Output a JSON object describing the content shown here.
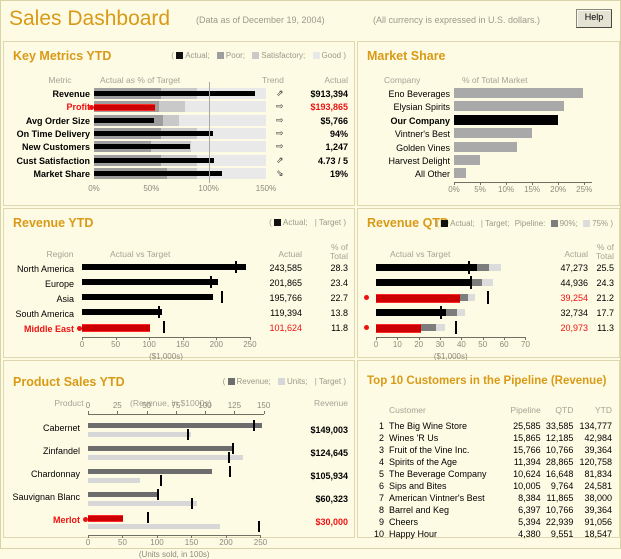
{
  "header": {
    "title": "Sales Dashboard",
    "as_of": "(Data as of December 19, 2004)",
    "currency_note": "(All currency is expressed in U.S. dollars.)",
    "help_label": "Help"
  },
  "key_metrics": {
    "title": "Key Metrics YTD",
    "legend": {
      "open": "(",
      "actual": "Actual;",
      "poor": "Poor;",
      "satisfactory": "Satisfactory;",
      "good": "Good",
      "close": ")"
    },
    "columns": {
      "metric": "Metric",
      "chart": "Actual as % of Target",
      "trend": "Trend",
      "actual": "Actual"
    },
    "axis_ticks": [
      "0%",
      "50%",
      "100%",
      "150%"
    ],
    "rows": [
      {
        "label": "Revenue",
        "actual_pct": 140,
        "poor": 58,
        "sat": 90,
        "good": 150,
        "trend": "up-right-arrow",
        "value": "$913,394",
        "alert": false
      },
      {
        "label": "Profit",
        "actual_pct": 53,
        "poor": 57,
        "sat": 79,
        "good": 150,
        "trend": "right-arrow",
        "value": "$193,865",
        "alert": true
      },
      {
        "label": "Avg Order Size",
        "actual_pct": 52,
        "poor": 60,
        "sat": 74,
        "good": 150,
        "trend": "right-arrow",
        "value": "$5,766",
        "alert": false
      },
      {
        "label": "On Time Delivery",
        "actual_pct": 104,
        "poor": 58,
        "sat": 90,
        "good": 150,
        "trend": "right-arrow",
        "value": "94%",
        "alert": false
      },
      {
        "label": "New Customers",
        "actual_pct": 84,
        "poor": 50,
        "sat": 85,
        "good": 150,
        "trend": "right-arrow",
        "value": "1,247",
        "alert": false
      },
      {
        "label": "Cust Satisfaction",
        "actual_pct": 105,
        "poor": 58,
        "sat": 90,
        "good": 150,
        "trend": "up-right-arrow",
        "value": "4.73 / 5",
        "alert": false
      },
      {
        "label": "Market Share",
        "actual_pct": 112,
        "poor": 64,
        "sat": 90,
        "good": 150,
        "trend": "down-right-arrow",
        "value": "19%",
        "alert": false
      }
    ]
  },
  "market_share": {
    "title": "Market Share",
    "columns": {
      "company": "Company",
      "chart": "% of Total Market"
    },
    "axis_ticks": [
      "0%",
      "5%",
      "10%",
      "15%",
      "20%",
      "25%"
    ],
    "rows": [
      {
        "label": "Eno Beverages",
        "value": 24.8,
        "highlight": false
      },
      {
        "label": "Elysian Spirits",
        "value": 21.2,
        "highlight": false
      },
      {
        "label": "Our Company",
        "value": 19.9,
        "highlight": true
      },
      {
        "label": "Vintner's Best",
        "value": 14.9,
        "highlight": false
      },
      {
        "label": "Golden Vines",
        "value": 12.1,
        "highlight": false
      },
      {
        "label": "Harvest Delight",
        "value": 5.0,
        "highlight": false
      },
      {
        "label": "All Other",
        "value": 2.4,
        "highlight": false
      }
    ]
  },
  "revenue_ytd": {
    "title": "Revenue YTD",
    "legend": {
      "open": "(",
      "actual": "Actual;",
      "target_bar": "|",
      "target": "Target",
      "close": ")"
    },
    "columns": {
      "region": "Region",
      "chart": "Actual vs Target",
      "actual": "Actual",
      "pct_line1": "% of",
      "pct_line2": "Total"
    },
    "axis_ticks": [
      "0",
      "50",
      "100",
      "150",
      "200",
      "250"
    ],
    "axis_title": "($1,000s)",
    "rows": [
      {
        "label": "North America",
        "actual": 243.585,
        "target": 228,
        "value": "243,585",
        "pct": "28.3",
        "alert": false
      },
      {
        "label": "Europe",
        "actual": 201.865,
        "target": 191,
        "value": "201,865",
        "pct": "23.4",
        "alert": false
      },
      {
        "label": "Asia",
        "actual": 195.766,
        "target": 207,
        "value": "195,766",
        "pct": "22.7",
        "alert": false
      },
      {
        "label": "South America",
        "actual": 119.394,
        "target": 113,
        "value": "119,394",
        "pct": "13.8",
        "alert": false
      },
      {
        "label": "Middle East",
        "actual": 101.624,
        "target": 121,
        "value": "101,624",
        "pct": "11.8",
        "alert": true
      }
    ]
  },
  "revenue_qtd": {
    "title": "Revenue QTD",
    "legend": {
      "open": "(",
      "actual": "Actual;",
      "target_bar": "|",
      "target": "Target;",
      "pipeline": "Pipeline:",
      "p90": "90%;",
      "p75": "75%",
      "close": ")"
    },
    "columns": {
      "chart": "Actual vs Target",
      "actual": "Actual",
      "pct_line1": "% of",
      "pct_line2": "Total"
    },
    "axis_ticks": [
      "0",
      "10",
      "20",
      "30",
      "40",
      "50",
      "60",
      "70"
    ],
    "axis_title": "($1,000s)",
    "rows": [
      {
        "actual": 47.273,
        "pipe90": 53.0,
        "pipe75": 58.5,
        "target": 43.0,
        "value": "47,273",
        "pct": "25.5",
        "alert": false
      },
      {
        "actual": 44.936,
        "pipe90": 49.5,
        "pipe75": 55.0,
        "target": 44.0,
        "value": "44,936",
        "pct": "24.3",
        "alert": false
      },
      {
        "actual": 39.254,
        "pipe90": 43.0,
        "pipe75": 46.5,
        "target": 52.0,
        "value": "39,254",
        "pct": "21.2",
        "alert": true
      },
      {
        "actual": 32.734,
        "pipe90": 38.0,
        "pipe75": 41.5,
        "target": 30.0,
        "value": "32,734",
        "pct": "17.7",
        "alert": false
      },
      {
        "actual": 20.973,
        "pipe90": 28.0,
        "pipe75": 32.5,
        "target": 37.0,
        "value": "20,973",
        "pct": "11.3",
        "alert": true
      }
    ]
  },
  "product_sales": {
    "title": "Product Sales YTD",
    "legend": {
      "open": "(",
      "revenue": "Revenue;",
      "units": "Units;",
      "target_bar": "|",
      "target": "Target",
      "close": ")"
    },
    "columns": {
      "product": "Product",
      "chart": "(Revenue, in $1000s)",
      "revenue": "Revenue"
    },
    "top_axis_ticks": [
      "0",
      "25",
      "50",
      "75",
      "100",
      "125",
      "150"
    ],
    "bottom_axis_ticks": [
      "0",
      "50",
      "100",
      "150",
      "200",
      "250"
    ],
    "bottom_axis_title": "(Units sold, in 100s)",
    "rows": [
      {
        "label": "Cabernet",
        "revenue": 149.003,
        "rev_target": 141,
        "units": 150,
        "units_target": 143,
        "value": "$149,003",
        "alert": false
      },
      {
        "label": "Zinfandel",
        "revenue": 124.645,
        "rev_target": 123,
        "units": 225,
        "units_target": 203,
        "value": "$124,645",
        "alert": false
      },
      {
        "label": "Chardonnay",
        "revenue": 105.934,
        "rev_target": 120,
        "units": 75,
        "units_target": 105,
        "value": "$105,934",
        "alert": false
      },
      {
        "label": "Sauvignan Blanc",
        "revenue": 60.323,
        "rev_target": 59,
        "units": 158,
        "units_target": 150,
        "value": "$60,323",
        "alert": false
      },
      {
        "label": "Merlot",
        "revenue": 30.0,
        "rev_target": 50,
        "units": 192,
        "units_target": 247,
        "value": "$30,000",
        "alert": true
      }
    ]
  },
  "top_customers": {
    "title": "Top 10 Customers in the Pipeline (Revenue)",
    "columns": {
      "customer": "Customer",
      "pipeline": "Pipeline",
      "qtd": "QTD",
      "ytd": "YTD"
    },
    "rows": [
      {
        "rank": "1",
        "customer": "The Big Wine Store",
        "pipeline": "25,585",
        "qtd": "33,585",
        "ytd": "134,777"
      },
      {
        "rank": "2",
        "customer": "Wines 'R Us",
        "pipeline": "15,865",
        "qtd": "12,185",
        "ytd": "42,984"
      },
      {
        "rank": "3",
        "customer": "Fruit of the Vine Inc.",
        "pipeline": "15,766",
        "qtd": "10,766",
        "ytd": "39,364"
      },
      {
        "rank": "4",
        "customer": "Spirits of the Age",
        "pipeline": "11,394",
        "qtd": "28,865",
        "ytd": "120,758"
      },
      {
        "rank": "5",
        "customer": "The Beverage Company",
        "pipeline": "10,624",
        "qtd": "16,648",
        "ytd": "81,834"
      },
      {
        "rank": "6",
        "customer": "Sips and Bites",
        "pipeline": "10,005",
        "qtd": "9,764",
        "ytd": "24,581"
      },
      {
        "rank": "7",
        "customer": "American Vintner's Best",
        "pipeline": "8,384",
        "qtd": "11,865",
        "ytd": "38,000"
      },
      {
        "rank": "8",
        "customer": "Barrel and Keg",
        "pipeline": "6,397",
        "qtd": "10,766",
        "ytd": "39,364"
      },
      {
        "rank": "9",
        "customer": "Cheers",
        "pipeline": "5,394",
        "qtd": "22,939",
        "ytd": "91,056"
      },
      {
        "rank": "10",
        "customer": "Happy Hour",
        "pipeline": "4,380",
        "qtd": "9,551",
        "ytd": "18,547"
      }
    ]
  },
  "colors": {
    "background": "#fdfbe4",
    "accent_title": "#d99a18",
    "alert": "#ee1111",
    "actual": "#000000",
    "poor": "#9e9e9e",
    "satisfactory": "#c9c9c9",
    "good": "#e9e9e9"
  }
}
